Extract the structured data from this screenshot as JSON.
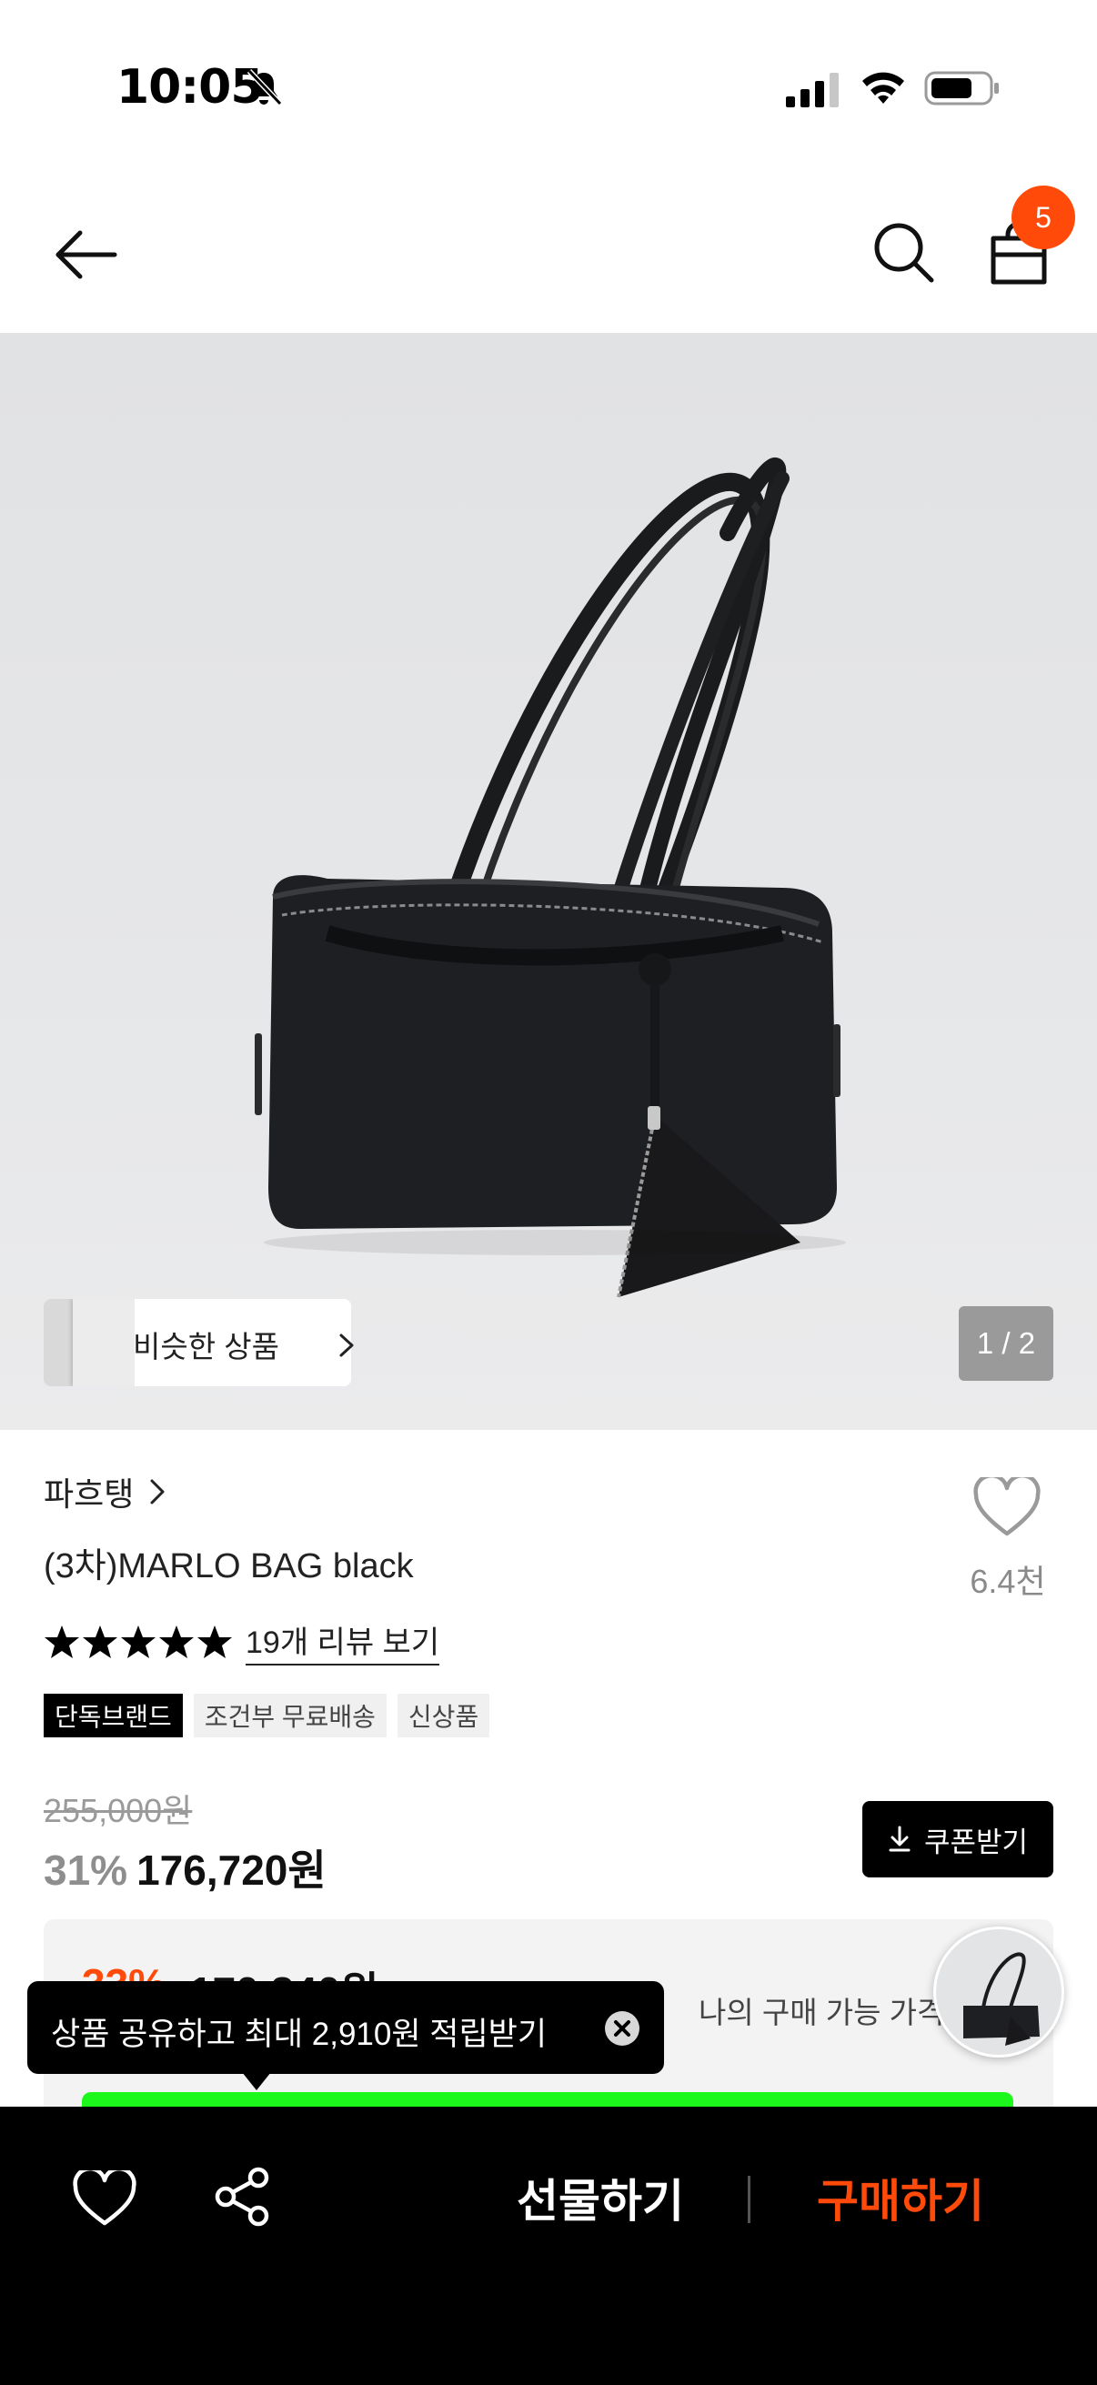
{
  "status_bar": {
    "time": "10:05"
  },
  "header": {
    "cart_count": "5"
  },
  "gallery": {
    "similar_label": "비슷한 상품",
    "counter": "1 / 2"
  },
  "product": {
    "brand": "파흐탱",
    "title": "(3차)MARLO BAG black",
    "wishlist_count": "6.4천",
    "rating_stars": 5,
    "review_link": "19개 리뷰 보기",
    "tags": [
      "단독브랜드",
      "조건부 무료배송",
      "신상품"
    ],
    "original_price": "255,000원",
    "discount_rate": "31%",
    "sale_price": "176,720원",
    "coupon_label": "쿠폰받기"
  },
  "member_price": {
    "discount": "33%",
    "price": "170,840원",
    "label": "나의 구매 가능 가격"
  },
  "tooltip": {
    "text": "상품 공유하고 최대 2,910원 적립받기"
  },
  "bottom_bar": {
    "gift_label": "선물하기",
    "buy_label": "구매하기"
  },
  "colors": {
    "accent": "#ff4a0a",
    "highlight_bar": "#1cf71c",
    "dark": "#000000"
  }
}
